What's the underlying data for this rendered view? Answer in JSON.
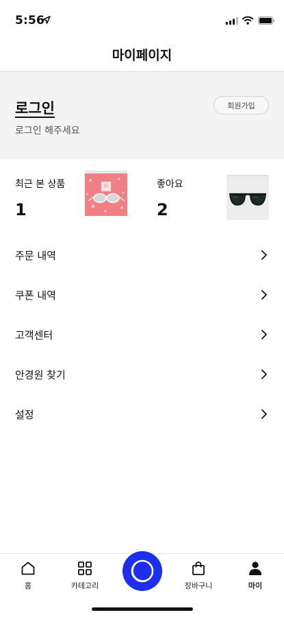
{
  "status": {
    "time": "5:56"
  },
  "header": {
    "title": "마이페이지"
  },
  "login": {
    "title": "로그인",
    "subtitle": "로그인 해주세요",
    "signup_label": "회원가입"
  },
  "stats": [
    {
      "label": "최근 본 상품",
      "value": "1",
      "thumb_icon": "pink-sunglasses-image"
    },
    {
      "label": "좋아요",
      "value": "2",
      "thumb_icon": "dark-sunglasses-image"
    }
  ],
  "menu": [
    {
      "label": "주문 내역"
    },
    {
      "label": "쿠폰 내역"
    },
    {
      "label": "고객센터"
    },
    {
      "label": "안경원 찾기"
    },
    {
      "label": "설정"
    }
  ],
  "tabs": [
    {
      "label": "홈",
      "icon": "home-icon"
    },
    {
      "label": "카테고리",
      "icon": "grid-icon"
    },
    {
      "label": "장바구니",
      "icon": "bag-icon"
    },
    {
      "label": "마이",
      "icon": "person-icon",
      "active": true
    }
  ],
  "colors": {
    "accent": "#1c2ef0",
    "section_bg": "#f4f4f5",
    "thumb_pink": "#f07f86"
  }
}
